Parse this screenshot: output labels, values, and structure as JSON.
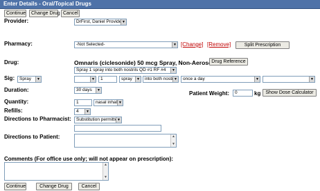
{
  "header": {
    "title": "Enter Details - Oral/Topical Drugs"
  },
  "top_buttons": {
    "continue": "Continue",
    "change_drug": "Change Drug",
    "cancel": "Cancel"
  },
  "provider": {
    "label": "Provider:",
    "value": "DrFirst, Daniel Provider"
  },
  "pharmacy": {
    "label": "Pharmacy:",
    "value": "-Not Selected-",
    "change": "[Change]",
    "remove": "[Remove]",
    "split": "Split Prescription"
  },
  "drug": {
    "label": "Drug:",
    "name": "Omnaris (ciclesonide) 50 mcg Spray, Non-Aerosol",
    "reference": "Drug Reference",
    "sig_select": "Spray 1 spray into both nostrils QD #1 RF #4"
  },
  "sig": {
    "label": "Sig:",
    "type": "Spray",
    "qty": "1",
    "unit": "spray",
    "route": "into both nostrils",
    "frequency": "once a day",
    "extra": ""
  },
  "duration": {
    "label": "Duration:",
    "value": "30 days"
  },
  "weight": {
    "label": "Patient Weight:",
    "value": "0",
    "unit": "kg",
    "button": "Show Dose Calculator"
  },
  "quantity": {
    "label": "Quantity:",
    "value": "1",
    "unit": "nasal inhaler"
  },
  "refills": {
    "label": "Refills:",
    "value": "4"
  },
  "pharmacist": {
    "label": "Directions to Pharmacist:",
    "value": "Substitution permitted",
    "note": ""
  },
  "patient": {
    "label": "Directions to Patient:"
  },
  "comments": {
    "label": "Comments (For office use only; will not appear on prescription):"
  },
  "bottom_buttons": {
    "continue": "Continue",
    "change_drug": "Change Drug",
    "cancel": "Cancel"
  },
  "colors": {
    "header_bg": "#4e72a8",
    "link": "#c00000"
  }
}
